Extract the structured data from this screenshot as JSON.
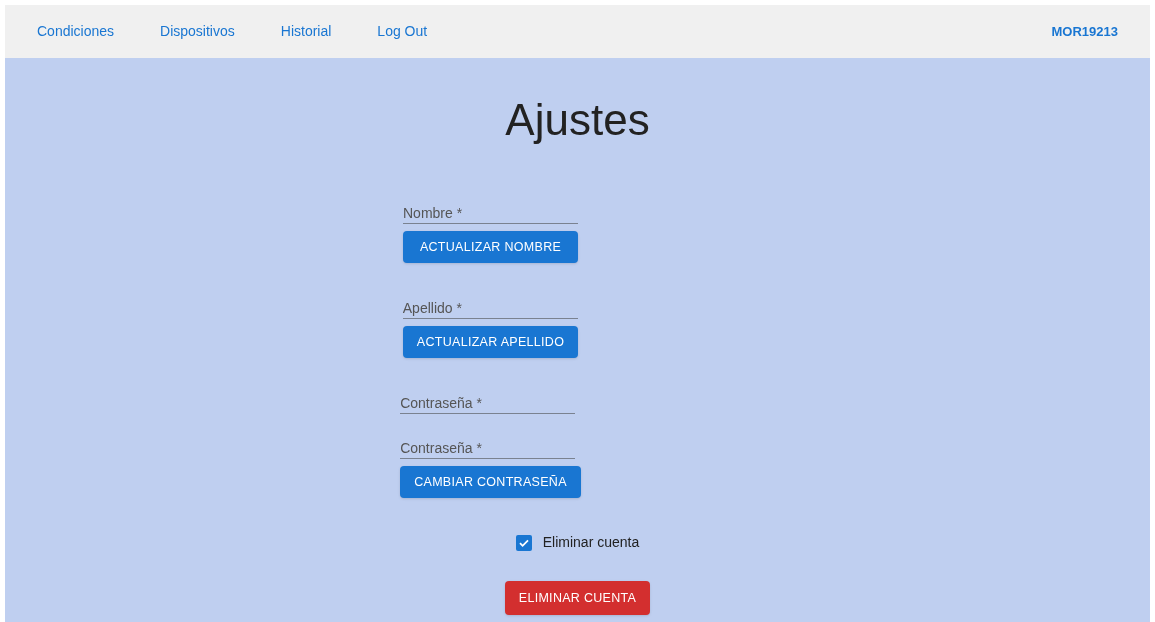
{
  "nav": {
    "links": [
      {
        "label": "Condiciones"
      },
      {
        "label": "Dispositivos"
      },
      {
        "label": "Historial"
      },
      {
        "label": "Log Out"
      }
    ],
    "user": "MOR19213"
  },
  "title": "Ajustes",
  "groups": [
    {
      "fields": [
        {
          "placeholder": "Nombre *"
        }
      ],
      "button": "ACTUALIZAR NOMBRE"
    },
    {
      "fields": [
        {
          "placeholder": "Apellido *"
        }
      ],
      "button": "ACTUALIZAR APELLIDO"
    },
    {
      "fields": [
        {
          "placeholder": "Contraseña *"
        },
        {
          "placeholder": "Contraseña *"
        }
      ],
      "button": "CAMBIAR CONTRASEÑA"
    }
  ],
  "delete_checkbox": {
    "label": "Eliminar cuenta",
    "checked": true
  },
  "delete_button": "ELIMINAR CUENTA"
}
